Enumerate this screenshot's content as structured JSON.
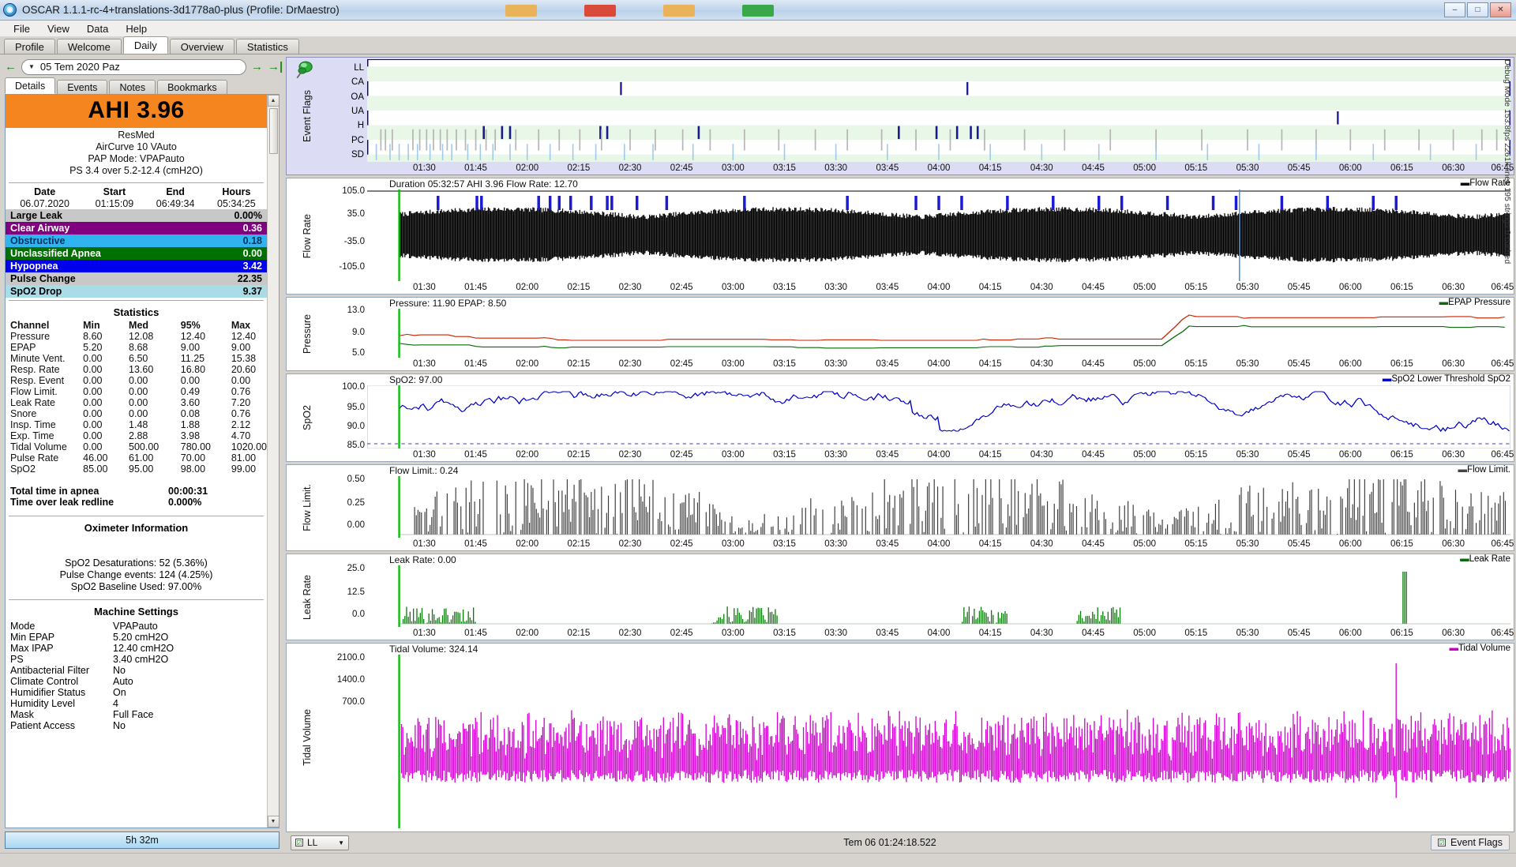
{
  "window": {
    "title": "OSCAR 1.1.1-rc-4+translations-3d1778a0-plus (Profile: DrMaestro)",
    "icon": "oscar-app-icon",
    "minimize": "–",
    "maximize": "□",
    "close": "✕"
  },
  "menu": [
    "File",
    "View",
    "Data",
    "Help"
  ],
  "main_tabs": [
    {
      "label": "Profile",
      "active": false
    },
    {
      "label": "Welcome",
      "active": false
    },
    {
      "label": "Daily",
      "active": true
    },
    {
      "label": "Overview",
      "active": false
    },
    {
      "label": "Statistics",
      "active": false
    }
  ],
  "date_nav": {
    "prev_icon": "arrow-left-icon",
    "date": "05 Tem 2020 Paz",
    "caret": "▼",
    "next_icon": "arrow-right-icon",
    "last_icon": "arrow-right-end-icon"
  },
  "sub_tabs": [
    {
      "label": "Details",
      "active": true
    },
    {
      "label": "Events",
      "active": false
    },
    {
      "label": "Notes",
      "active": false
    },
    {
      "label": "Bookmarks",
      "active": false
    }
  ],
  "details": {
    "ahi_label": "AHI 3.96",
    "ahi_color": "#f5851f",
    "machine": [
      "ResMed",
      "AirCurve 10 VAuto",
      "PAP Mode: VPAPauto",
      "PS 3.4 over 5.2-12.4 (cmH2O)"
    ],
    "session_headers": [
      "Date",
      "Start",
      "End",
      "Hours"
    ],
    "session_values": [
      "06.07.2020",
      "01:15:09",
      "06:49:34",
      "05:34:25"
    ],
    "events": [
      {
        "label": "Large Leak",
        "value": "0.00%",
        "bg": "#c8c8c8",
        "fg": "#000000"
      },
      {
        "label": "Clear Airway",
        "value": "0.36",
        "bg": "#800080",
        "fg": "#ffffff"
      },
      {
        "label": "Obstructive",
        "value": "0.18",
        "bg": "#2fb4ef",
        "fg": "#003366"
      },
      {
        "label": "Unclassified Apnea",
        "value": "0.00",
        "bg": "#007000",
        "fg": "#ffffff"
      },
      {
        "label": "Hypopnea",
        "value": "3.42",
        "bg": "#0000ee",
        "fg": "#ffffff"
      },
      {
        "label": "Pulse Change",
        "value": "22.35",
        "bg": "#c8c8c8",
        "fg": "#000000"
      },
      {
        "label": "SpO2 Drop",
        "value": "9.37",
        "bg": "#a8dde8",
        "fg": "#000000"
      }
    ],
    "stats_title": "Statistics",
    "stats_headers": [
      "Channel",
      "Min",
      "Med",
      "95%",
      "Max"
    ],
    "stats_rows": [
      [
        "Pressure",
        "8.60",
        "12.08",
        "12.40",
        "12.40"
      ],
      [
        "EPAP",
        "5.20",
        "8.68",
        "9.00",
        "9.00"
      ],
      [
        "Minute Vent.",
        "0.00",
        "6.50",
        "11.25",
        "15.38"
      ],
      [
        "Resp. Rate",
        "0.00",
        "13.60",
        "16.80",
        "20.60"
      ],
      [
        "Resp. Event",
        "0.00",
        "0.00",
        "0.00",
        "0.00"
      ],
      [
        "Flow Limit.",
        "0.00",
        "0.00",
        "0.49",
        "0.76"
      ],
      [
        "Leak Rate",
        "0.00",
        "0.00",
        "3.60",
        "7.20"
      ],
      [
        "Snore",
        "0.00",
        "0.00",
        "0.08",
        "0.76"
      ],
      [
        "Insp. Time",
        "0.00",
        "1.48",
        "1.88",
        "2.12"
      ],
      [
        "Exp. Time",
        "0.00",
        "2.88",
        "3.98",
        "4.70"
      ],
      [
        "Tidal Volume",
        "0.00",
        "500.00",
        "780.00",
        "1020.00"
      ],
      [
        "Pulse Rate",
        "46.00",
        "61.00",
        "70.00",
        "81.00"
      ],
      [
        "SpO2",
        "85.00",
        "95.00",
        "98.00",
        "99.00"
      ]
    ],
    "totals": [
      {
        "label": "Total time in apnea",
        "value": "00:00:31"
      },
      {
        "label": "Time over leak redline",
        "value": "0.000%"
      }
    ],
    "oximeter_title": "Oximeter Information",
    "oximeter_lines": [
      "SpO2 Desaturations: 52 (5.36%)",
      "Pulse Change events: 124 (4.25%)",
      "SpO2 Baseline Used: 97.00%"
    ],
    "machine_settings_title": "Machine Settings",
    "machine_settings": [
      {
        "key": "Mode",
        "value": "VPAPauto"
      },
      {
        "key": "Min EPAP",
        "value": "5.20 cmH2O"
      },
      {
        "key": "Max IPAP",
        "value": "12.40 cmH2O"
      },
      {
        "key": "PS",
        "value": "3.40 cmH2O"
      },
      {
        "key": "Antibacterial Filter",
        "value": "No"
      },
      {
        "key": "Climate Control",
        "value": "Auto"
      },
      {
        "key": "Humidifier Status",
        "value": "On"
      },
      {
        "key": "Humidity Level",
        "value": "4"
      },
      {
        "key": "Mask",
        "value": "Full Face"
      },
      {
        "key": "Patient Access",
        "value": "No"
      }
    ],
    "hours_bar": "5h 32m"
  },
  "xticks": [
    "01:30",
    "01:45",
    "02:00",
    "02:15",
    "02:30",
    "02:45",
    "03:00",
    "03:15",
    "03:30",
    "03:45",
    "04:00",
    "04:15",
    "04:30",
    "04:45",
    "05:00",
    "05:15",
    "05:30",
    "05:45",
    "06:00",
    "06:15",
    "06:30",
    "06:45"
  ],
  "graphs": {
    "event_flags": {
      "side_label": "Event Flags",
      "pin_icon": "pushpin-icon",
      "rows": [
        "LL",
        "CA",
        "OA",
        "UA",
        "H",
        "PC",
        "SD"
      ]
    },
    "flow_rate": {
      "side_label": "Flow Rate",
      "title": "Duration 05:32:57 AHI 3.96 Flow Rate: 12.70",
      "legend": "Flow Rate",
      "legend_color": "#000000",
      "yticks": [
        "105.0",
        "35.0",
        "-35.0",
        "-105.0"
      ]
    },
    "pressure": {
      "side_label": "Pressure",
      "title": "Pressure: 11.90 EPAP: 8.50",
      "legend": "EPAP   Pressure",
      "legend_epap_color": "#0a6b0a",
      "legend_pressure_color": "#cc2200",
      "yticks": [
        "13.0",
        "9.0",
        "5.0"
      ]
    },
    "spo2": {
      "side_label": "SpO2",
      "title": "SpO2: 97.00",
      "legend": "SpO2 Lower Threshold   SpO2",
      "legend_color": "#0000cc",
      "yticks": [
        "100.0",
        "95.0",
        "90.0",
        "85.0"
      ]
    },
    "flow_limit": {
      "side_label": "Flow Limit.",
      "title": "Flow Limit.: 0.24",
      "legend": "Flow Limit.",
      "legend_color": "#444444",
      "yticks": [
        "0.50",
        "0.25",
        "0.00"
      ]
    },
    "leak_rate": {
      "side_label": "Leak Rate",
      "title": "Leak Rate: 0.00",
      "legend": "Leak Rate",
      "legend_color": "#0a6b0a",
      "yticks": [
        "25.0",
        "12.5",
        "0.0"
      ]
    },
    "tidal_volume": {
      "side_label": "Tidal Volume",
      "title": "Tidal Volume: 324.14",
      "legend": "Tidal Volume",
      "legend_color": "#cc00cc",
      "yticks": [
        "2100.0",
        "1400.0",
        "700.0"
      ]
    }
  },
  "debug_text": "Debug Mode 153.8fps 2261k lines 195 strings 0 cached",
  "bottom_bar": {
    "combo_label": "LL",
    "combo_caret": "▼",
    "combo_check": "☑",
    "center_text": "Tem 06 01:24:18.522",
    "event_flags_label": "Event Flags",
    "event_flags_check": "☑"
  }
}
